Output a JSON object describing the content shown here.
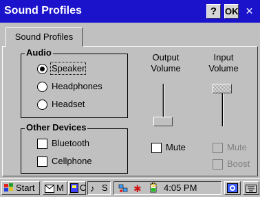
{
  "window": {
    "title": "Sound Profiles",
    "help_label": "?",
    "ok_label": "OK",
    "close_glyph": "×"
  },
  "tabs": [
    {
      "label": "Sound Profiles",
      "selected": true
    }
  ],
  "audio": {
    "group_label": "Audio",
    "options": [
      {
        "label": "Speaker",
        "selected": true
      },
      {
        "label": "Headphones",
        "selected": false
      },
      {
        "label": "Headset",
        "selected": false
      }
    ]
  },
  "other_devices": {
    "group_label": "Other Devices",
    "options": [
      {
        "label": "Bluetooth",
        "checked": false
      },
      {
        "label": "Cellphone",
        "checked": false
      }
    ]
  },
  "output_volume": {
    "label_line1": "Output",
    "label_line2": "Volume",
    "level": 0.0,
    "mute_label": "Mute",
    "muted": false
  },
  "input_volume": {
    "label_line1": "Input",
    "label_line2": "Volume",
    "level": 1.0,
    "mute_label": "Mute",
    "muted": false,
    "boost_label": "Boost",
    "boost": false,
    "enabled": false
  },
  "taskbar": {
    "start_label": "Start",
    "tasks": [
      {
        "icon": "mail-icon",
        "label": "M"
      },
      {
        "icon": "control-panel-icon",
        "label": "C"
      },
      {
        "icon": "sound-icon",
        "label": "S"
      }
    ],
    "clock": "4:05 PM",
    "tray_icons": [
      "network-icon",
      "virus-icon",
      "battery-icon"
    ],
    "colors": {
      "title_bar": "#1b12cc",
      "face": "#c0c0c0"
    }
  }
}
